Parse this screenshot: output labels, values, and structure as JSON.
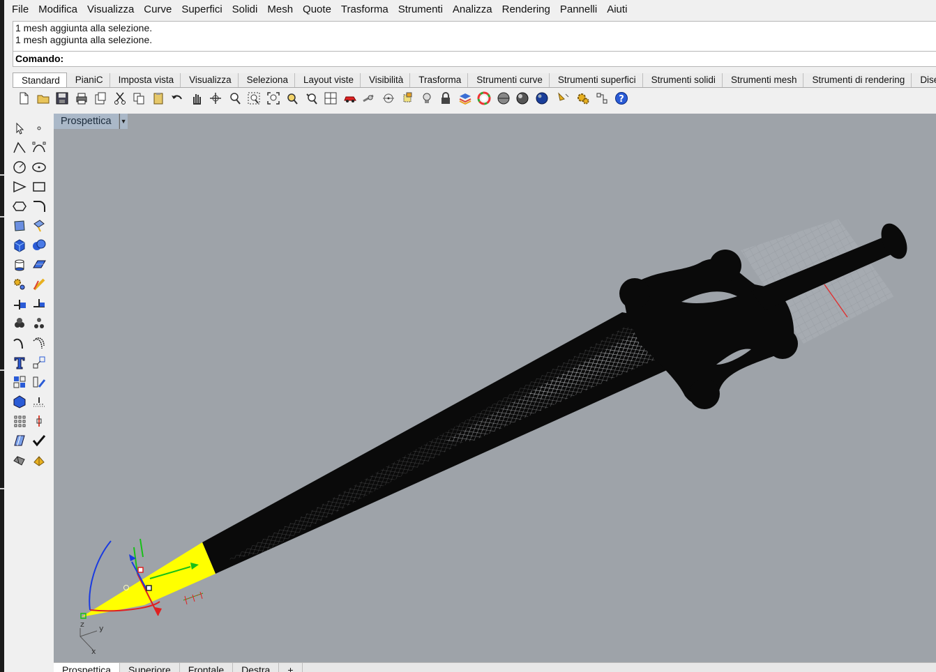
{
  "menu": [
    "File",
    "Modifica",
    "Visualizza",
    "Curve",
    "Superfici",
    "Solidi",
    "Mesh",
    "Quote",
    "Trasforma",
    "Strumenti",
    "Analizza",
    "Rendering",
    "Pannelli",
    "Aiuti"
  ],
  "command_history": [
    "1 mesh aggiunta alla selezione.",
    "1 mesh aggiunta alla selezione."
  ],
  "command_prompt": "Comando:",
  "toolbar_tabs": [
    "Standard",
    "PianiC",
    "Imposta vista",
    "Visualizza",
    "Seleziona",
    "Layout viste",
    "Visibilità",
    "Trasforma",
    "Strumenti curve",
    "Strumenti superfici",
    "Strumenti solidi",
    "Strumenti mesh",
    "Strumenti di rendering",
    "Dise"
  ],
  "active_toolbar_tab": "Standard",
  "toolbar_icons": [
    "new-file-icon",
    "open-folder-icon",
    "save-icon",
    "print-icon",
    "import-icon",
    "cut-icon",
    "copy-icon",
    "paste-icon",
    "undo-icon",
    "pan-hand-icon",
    "rotate-view-icon",
    "zoom-icon",
    "zoom-window-icon",
    "zoom-extents-icon",
    "zoom-selected-icon",
    "undo-view-icon",
    "four-viewports-icon",
    "car-properties-icon",
    "snap-icon",
    "gumball-icon",
    "lights-icon",
    "lock-icon",
    "layer-icon",
    "color-wheel-icon",
    "shaded-sphere-icon",
    "rendered-sphere-icon",
    "render-sphere-icon",
    "dimension-icon",
    "settings-gears-icon",
    "selection-filter-icon",
    "help-icon"
  ],
  "palette_icons": [
    "select-arrow-icon",
    "point-icon",
    "polyline-icon",
    "curve-cv-icon",
    "circle-icon",
    "ellipse-icon",
    "arc-icon",
    "rectangle-icon",
    "polygon-icon",
    "fillet-icon",
    "surface-pts-icon",
    "extrude-icon",
    "box-icon",
    "sphere-icon",
    "cylinder-icon",
    "plane-icon",
    "solid-tools-icon",
    "boolean-icon",
    "split-icon",
    "trim-icon",
    "group-icon",
    "ungroup-icon",
    "curve-tools-icon",
    "offset-icon",
    "text-icon",
    "scale-icon",
    "array-icon",
    "mirror-icon",
    "block-icon",
    "dots-icon",
    "grid-array-icon",
    "gumball-small-icon",
    "analyze-icon",
    "check-icon",
    "mesh-icon",
    "render-obj-icon"
  ],
  "viewport": {
    "title": "Prospettica",
    "background": "#9ea3a9",
    "selection_color": "#ffff00",
    "axes": {
      "x": "x",
      "y": "y",
      "z": "z"
    }
  },
  "view_tabs": [
    "Prospettica",
    "Superiore",
    "Frontale",
    "Destra",
    "+"
  ],
  "active_view_tab": "Prospettica"
}
